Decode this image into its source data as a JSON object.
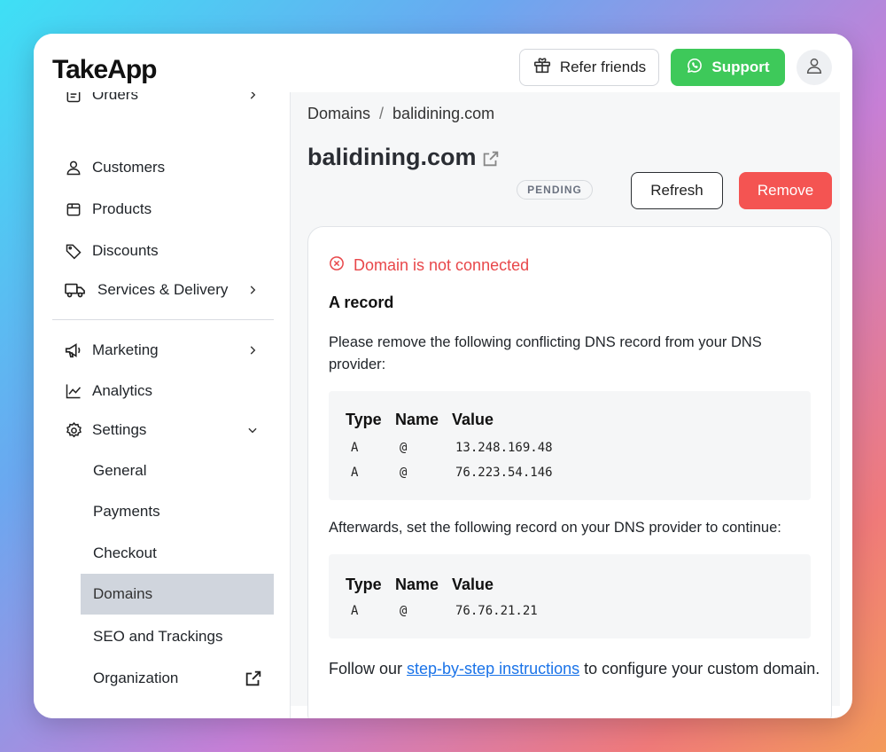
{
  "app": {
    "logo": "TakeApp"
  },
  "header": {
    "refer_label": "Refer friends",
    "support_label": "Support"
  },
  "sidebar": {
    "items": [
      {
        "label": "Orders"
      },
      {
        "label": "Customers"
      },
      {
        "label": "Products"
      },
      {
        "label": "Discounts"
      },
      {
        "label": "Services & Delivery"
      },
      {
        "label": "Marketing"
      },
      {
        "label": "Analytics"
      },
      {
        "label": "Settings"
      }
    ],
    "settings_sub": [
      {
        "label": "General"
      },
      {
        "label": "Payments"
      },
      {
        "label": "Checkout"
      },
      {
        "label": "Domains"
      },
      {
        "label": "SEO and Trackings"
      },
      {
        "label": "Organization"
      }
    ]
  },
  "breadcrumb": {
    "root": "Domains",
    "sep": "/",
    "current": "balidining.com"
  },
  "page": {
    "title": "balidining.com",
    "status_badge": "PENDING",
    "refresh_label": "Refresh",
    "remove_label": "Remove"
  },
  "card": {
    "status_text": "Domain is not connected",
    "record_title": "A record",
    "remove_instruction": "Please remove the following conflicting DNS record from your DNS provider:",
    "table_headers": [
      "Type",
      "Name",
      "Value"
    ],
    "conflicting_records": [
      {
        "type": "A",
        "name": "@",
        "value": "13.248.169.48"
      },
      {
        "type": "A",
        "name": "@",
        "value": "76.223.54.146"
      }
    ],
    "set_instruction": "Afterwards, set the following record on your DNS provider to continue:",
    "required_records": [
      {
        "type": "A",
        "name": "@",
        "value": "76.76.21.21"
      }
    ],
    "footer_prefix": "Follow our ",
    "footer_link": "step-by-step instructions",
    "footer_suffix": " to configure your custom domain."
  },
  "colors": {
    "support_green": "#3ec95a",
    "remove_red": "#f45452",
    "error_red": "#e8474a",
    "link_blue": "#1a73e8",
    "active_nav": "#d0d5dd"
  }
}
